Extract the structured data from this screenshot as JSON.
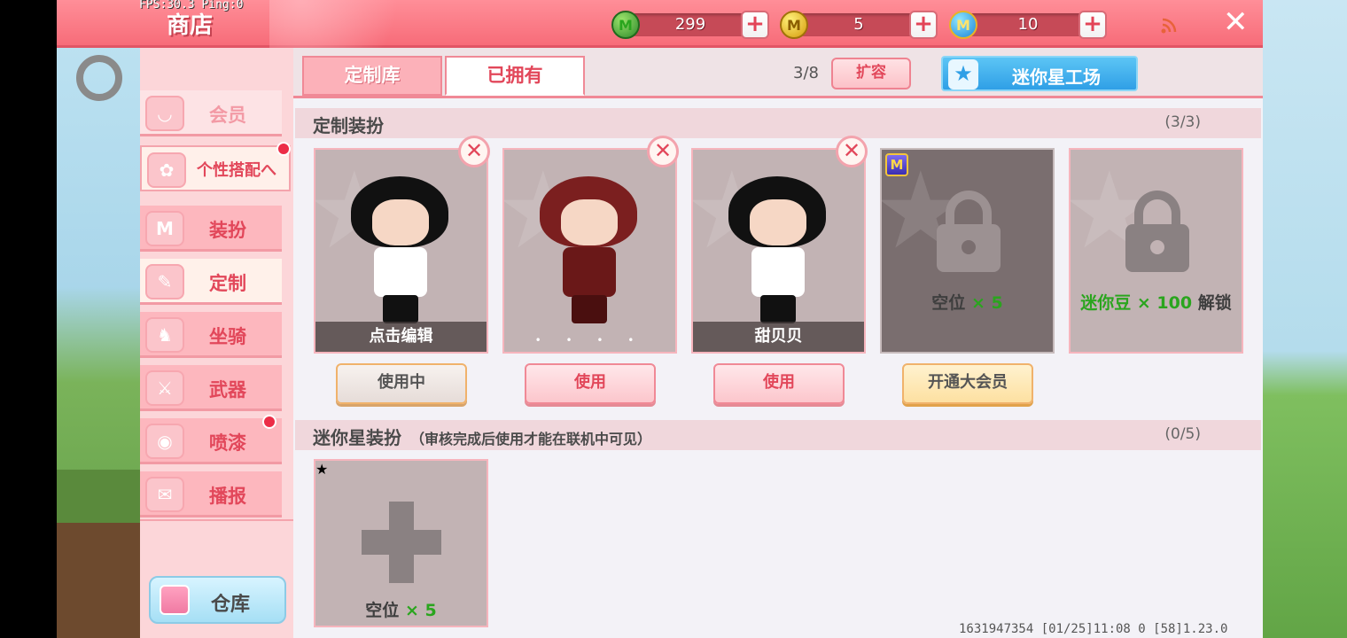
{
  "debug": {
    "fps_text": "FPS:30.3  Ping:0"
  },
  "header": {
    "title": "商店",
    "currencies": [
      {
        "icon": "green-gem-icon",
        "glyph": "M",
        "value": "299"
      },
      {
        "icon": "gold-coin-icon",
        "glyph": "M",
        "value": "5"
      },
      {
        "icon": "mini-coin-icon",
        "glyph": "M",
        "value": "10"
      }
    ],
    "plus_glyph": "+",
    "close_glyph": "✕"
  },
  "sidebar": {
    "items": [
      {
        "label": "会员",
        "icon": "vip-icon"
      },
      {
        "label": "个性搭配へ",
        "icon": "outfit-icon"
      },
      {
        "label": "装扮",
        "icon": "shirt-icon"
      },
      {
        "label": "定制",
        "icon": "pencil-icon"
      },
      {
        "label": "坐骑",
        "icon": "mount-icon"
      },
      {
        "label": "武器",
        "icon": "weapon-icon"
      },
      {
        "label": "喷漆",
        "icon": "spray-icon"
      },
      {
        "label": "播报",
        "icon": "broadcast-icon"
      }
    ],
    "warehouse_label": "仓库"
  },
  "tabs": [
    {
      "label": "定制库"
    },
    {
      "label": "已拥有"
    }
  ],
  "toolbar": {
    "slot_count": "3/8",
    "expand_label": "扩容",
    "workshop_label": "迷你星工场",
    "workshop_glyph": "★"
  },
  "sections": {
    "custom": {
      "title": "定制装扮",
      "count": "(3/3)",
      "cards": [
        {
          "caption": "点击编辑",
          "button": "使用中"
        },
        {
          "caption": "• • • •",
          "button": "使用"
        },
        {
          "caption": "甜贝贝",
          "button": "使用"
        },
        {
          "lock_prefix": "空位",
          "lock_value": "× 5",
          "button": "开通大会员",
          "badge": "M"
        },
        {
          "lock_prefix": "迷你豆",
          "lock_value": "× 100",
          "lock_suffix": "解锁"
        }
      ],
      "close_glyph": "✕"
    },
    "mini_star": {
      "title": "迷你星装扮",
      "note": "（审核完成后使用才能在联机中可见）",
      "count": "(0/5)",
      "empty_prefix": "空位",
      "empty_value": "× 5"
    }
  },
  "footer": {
    "info": "1631947354   [01/25]11:08 0   [58]1.23.0"
  },
  "colors": {
    "accent": "#f76c79",
    "tab_active": "#fcb1b9",
    "workshop": "#2f9fe6",
    "unlock_green": "#2aa51e"
  }
}
